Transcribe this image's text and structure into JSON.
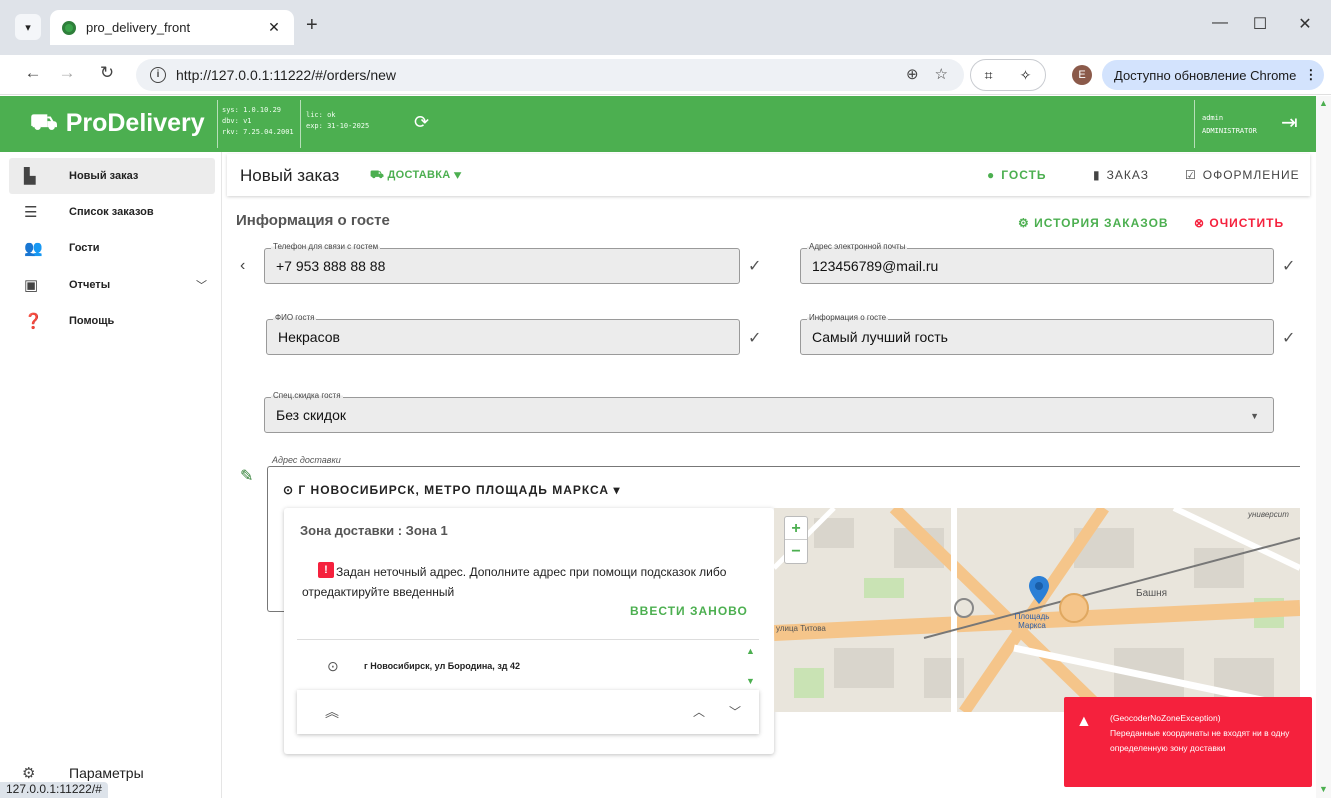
{
  "browser": {
    "tab_title": "pro_delivery_front",
    "url": "http://127.0.0.1:11222/#/orders/new",
    "profile_initial": "E",
    "update_label": "Доступно обновление Chrome",
    "status_url": "127.0.0.1:11222/#"
  },
  "header": {
    "logo": "ProDelivery",
    "sys": [
      "sys: 1.0.10.29",
      "dbv: v1",
      "rkv: 7.25.04.2001"
    ],
    "lic": [
      "lic: ok",
      "exp: 31-10-2025"
    ],
    "user_name": "admin",
    "user_role": "ADMINISTRATOR",
    "brand_color": "#4caf50"
  },
  "sidebar": {
    "items": [
      {
        "label": "Новый заказ",
        "icon": "new-order-icon"
      },
      {
        "label": "Список заказов",
        "icon": "list-icon"
      },
      {
        "label": "Гости",
        "icon": "people-icon"
      },
      {
        "label": "Отчеты",
        "icon": "clipboard-icon"
      },
      {
        "label": "Помощь",
        "icon": "help-icon"
      }
    ],
    "settings_label": "Параметры"
  },
  "page": {
    "title": "Новый заказ",
    "delivery_type": "ДОСТАВКА",
    "steps": [
      "ГОСТЬ",
      "ЗАКАЗ",
      "ОФОРМЛЕНИЕ"
    ],
    "active_step": "ГОСТЬ"
  },
  "guest": {
    "section_title": "Информация о госте",
    "history_button": "ИСТОРИЯ ЗАКАЗОВ",
    "clear_button": "ОЧИСТИТЬ",
    "phone_label": "Телефон для связи с гостем",
    "phone_value": "+7 953 888 88 88",
    "email_label": "Адрес электронной почты",
    "email_value": "123456789@mail.ru",
    "name_label": "ФИО гостя",
    "name_value": "Некрасов",
    "info_label": "Информация о госте",
    "info_value": "Самый лучший гость",
    "discount_label": "Спец.скидка гостя",
    "discount_value": "Без скидок"
  },
  "address": {
    "label": "Адрес доставки",
    "selected": "Г НОВОСИБИРСК, МЕТРО ПЛОЩАДЬ МАРКСА",
    "zone_title": "Зона доставки : Зона 1",
    "warning": "Задан неточный адрес. Дополните адрес при помощи подсказок либо отредактируйте введенный",
    "reenter_button": "ВВЕСТИ ЗАНОВО",
    "suggestion": "г Новосибирск, ул Бородина, зд 42"
  },
  "map": {
    "labels": [
      "Площадь Маркса",
      "Башня",
      "улица Титова",
      "университ"
    ]
  },
  "toast": {
    "title": "(GeocoderNoZoneException)",
    "message": "Переданные координаты не входят ни в одну определенную зону доставки",
    "color": "#f5213d"
  }
}
